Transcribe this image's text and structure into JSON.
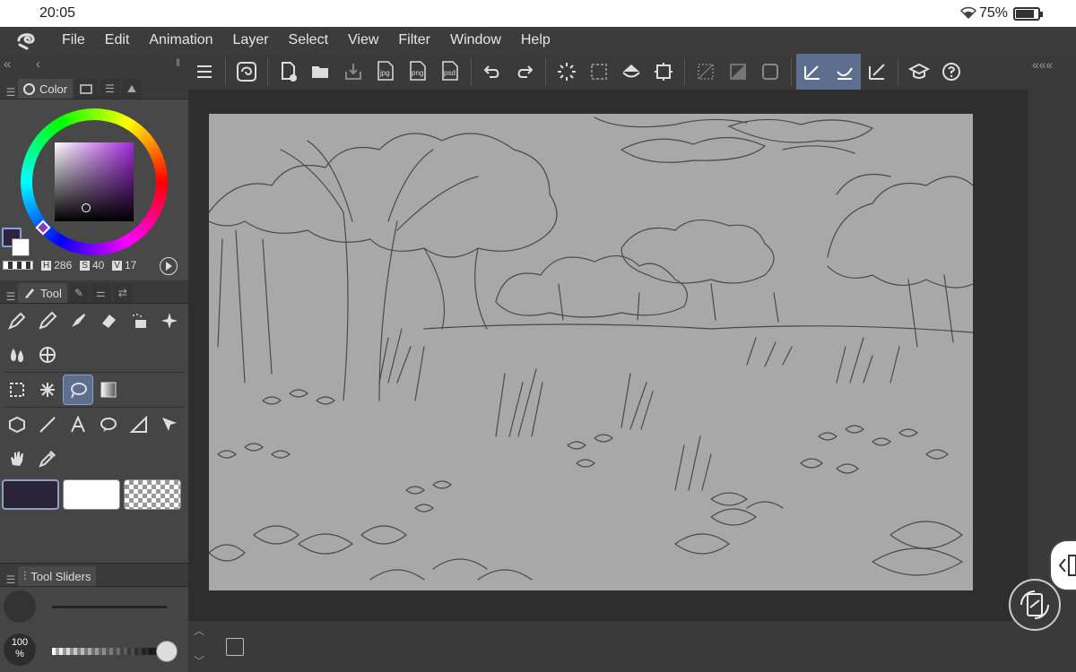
{
  "status": {
    "time": "20:05",
    "battery": "75%"
  },
  "menu": [
    "File",
    "Edit",
    "Animation",
    "Layer",
    "Select",
    "View",
    "Filter",
    "Window",
    "Help"
  ],
  "color_panel": {
    "tab_label": "Color",
    "h_key": "H",
    "h": "286",
    "s_key": "S",
    "s": "40",
    "v_key": "V",
    "v": "17",
    "fg_color": "#2c2440",
    "bg_color": "#ffffff",
    "hue_color": "#a229d9"
  },
  "tool_panel": {
    "tab_label": "Tool"
  },
  "tool_sliders": {
    "tab_label": "Tool Sliders",
    "opacity": "100",
    "opacity_unit": "%"
  },
  "toolbar_icons": {
    "jpg": "jpg",
    "png": "png",
    "psd": "psd"
  }
}
